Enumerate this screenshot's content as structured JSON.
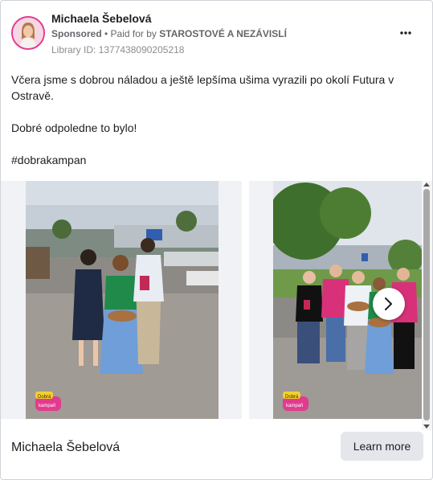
{
  "post": {
    "author_name": "Michaela Šebelová",
    "sponsored_label": "Sponsored",
    "separator": " • ",
    "paid_for_prefix": "Paid for by ",
    "payer_name": "STAROSTOVÉ A NEZÁVISLÍ",
    "library_id": "Library ID: 1377438090205218",
    "more_icon": "more-horizontal-icon",
    "paragraphs": [
      "Včera jsme s dobrou náladou a ještě lepšíma ušima vyrazili po okolí Futura v Ostravě.",
      "Dobré odpoledne to bylo!",
      "#dobrakampan"
    ]
  },
  "carousel": {
    "slides": [
      {
        "badge_line1": "Dobrá",
        "badge_line2": "kampaň"
      },
      {
        "badge_line1": "Dobrá",
        "badge_line2": "kampaň"
      }
    ],
    "next_icon": "chevron-right-icon"
  },
  "footer": {
    "page_name": "Michaela Šebelová",
    "cta_label": "Learn more"
  },
  "colors": {
    "accent_pink": "#e5398c",
    "cta_background": "#e4e6eb"
  }
}
